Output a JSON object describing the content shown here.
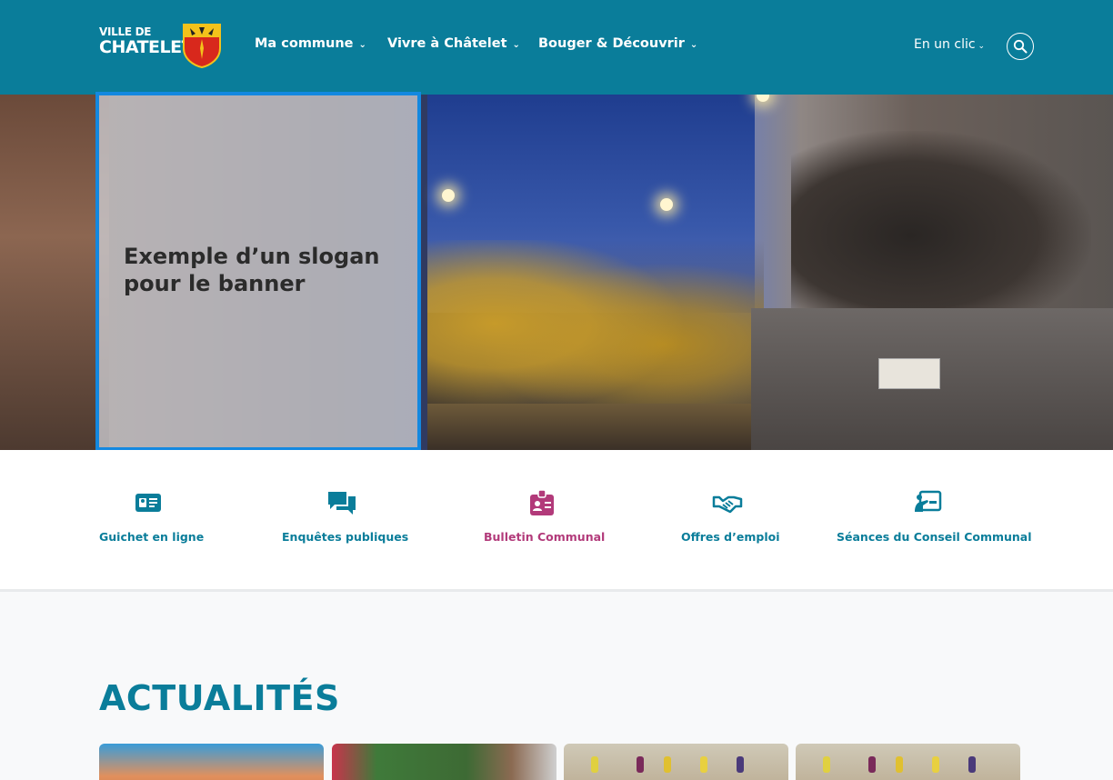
{
  "header": {
    "logo": {
      "line1": "VILLE DE",
      "line2": "CHATELET"
    },
    "nav": [
      {
        "label": "Ma commune"
      },
      {
        "label": "Vivre à Châtelet"
      },
      {
        "label": "Bouger & Découvrir"
      }
    ],
    "quick_menu_label": "En un clic",
    "icons": {
      "search": "search-icon",
      "chevron": "chevron-down-icon"
    }
  },
  "hero": {
    "slogan": "Exemple d’un slogan pour le banner"
  },
  "quick_links": [
    {
      "label": "Guichet en ligne",
      "icon": "id-card-icon",
      "color": "#0a7d9a"
    },
    {
      "label": "Enquêtes publiques",
      "icon": "chat-bubbles-icon",
      "color": "#0a7d9a"
    },
    {
      "label": "Bulletin Communal",
      "icon": "badge-icon",
      "color": "#b23a7a"
    },
    {
      "label": "Offres d’emploi",
      "icon": "handshake-icon",
      "color": "#0a7d9a"
    },
    {
      "label": "Séances du Conseil Communal",
      "icon": "presentation-icon",
      "color": "#0a7d9a"
    }
  ],
  "news": {
    "title": "ACTUALITÉS"
  },
  "colors": {
    "brand": "#0a7d9a",
    "accent_pink": "#b23a7a",
    "focus_blue": "#1388e0"
  }
}
